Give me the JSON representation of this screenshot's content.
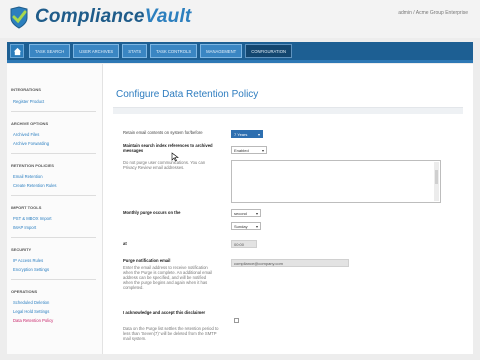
{
  "app": {
    "brand_part1": "Compliance",
    "brand_part2": "Vault",
    "user_info": "admin / Acme Group Enterprise"
  },
  "nav": {
    "tabs": [
      "TASK SEARCH",
      "USER ARCHIVES",
      "STATS",
      "TASK CONTROLS",
      "MANAGEMENT",
      "CONFIGURATION"
    ],
    "active_tab": "CONFIGURATION"
  },
  "sidebar": {
    "groups": [
      {
        "title": "INTEGRATIONS",
        "items": [
          "Register Product"
        ]
      },
      {
        "title": "ARCHIVE OPTIONS",
        "items": [
          "Archived Files",
          "Archive Forwarding"
        ]
      },
      {
        "title": "RETENTION POLICIES",
        "items": [
          "Email Retention",
          "Create Retention Rules"
        ]
      },
      {
        "title": "IMPORT TOOLS",
        "items": [
          "PST & MBOX Import",
          "IMAP Import"
        ]
      },
      {
        "title": "SECURITY",
        "items": [
          "IP Access Rules",
          "Encryption Settings"
        ]
      },
      {
        "title": "OPERATIONS",
        "items": [
          "Scheduled Deletion",
          "Legal Hold Settings",
          "Data Retention Policy"
        ]
      }
    ],
    "current_item": "Data Retention Policy"
  },
  "main": {
    "page_title": "Configure Data Retention Policy",
    "retain_label": "Retain email contents on system for/before",
    "retain_value": "7 Years",
    "delete_index_label": "Maintain search index references to archived messages",
    "delete_index_value": "Enabled",
    "delete_index_note": "Do not purge user communications. You can Privacy Review email addresses.",
    "monthly_purge_label": "Monthly purge occurs on the",
    "monthly_purge_value": "second",
    "monthly_purge_day": "Sunday",
    "at_label": "at",
    "at_value": "00:00",
    "notify_label": "Purge notification email",
    "notify_note": "Enter the email address to receive notification when the Purge is complete. An additional email address can be specified, and will be notified when the purge begins and again when it has completed.",
    "notify_value": "compliance@company.com",
    "ack_label": "I acknowledge and accept this disclaimer",
    "ack_note": "Data on the Purge list settles the retention period to less than 'Seven(7)' will be deleted from the SMTP mail system."
  }
}
